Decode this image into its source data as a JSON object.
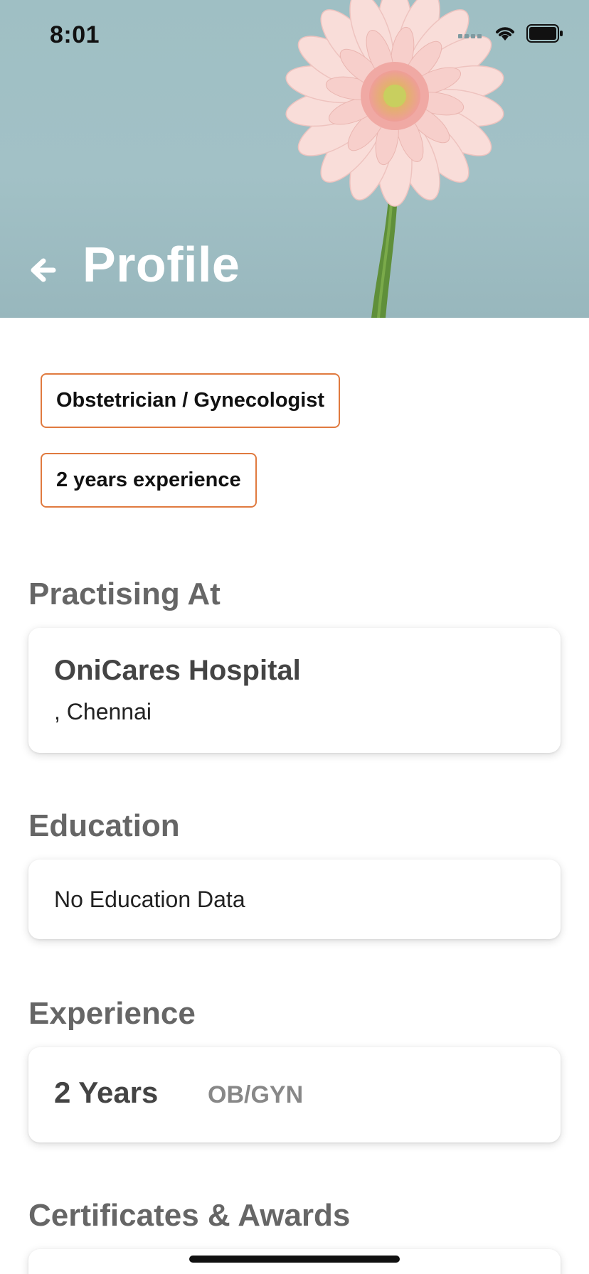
{
  "status_bar": {
    "time": "8:01",
    "icons": [
      "cellular-signal-icon",
      "wifi-icon",
      "battery-icon"
    ]
  },
  "header": {
    "title": "Profile",
    "back_icon": "arrow-left-icon",
    "background_colors": {
      "sky": "#9fbfc4",
      "petal": "#f6d2cf",
      "stem": "#5f8f3a"
    }
  },
  "tags": {
    "specialty": "Obstetrician / Gynecologist",
    "experience": "2 years experience",
    "border_color": "#e07a3f"
  },
  "sections": {
    "practising": {
      "title": "Practising At",
      "hospital_name": "OniCares Hospital",
      "hospital_city": ", Chennai"
    },
    "education": {
      "title": "Education",
      "empty_text": "No Education Data"
    },
    "experience": {
      "title": "Experience",
      "years": "2 Years",
      "specialty": "OB/GYN"
    },
    "certificates": {
      "title": "Certificates & Awards"
    }
  }
}
